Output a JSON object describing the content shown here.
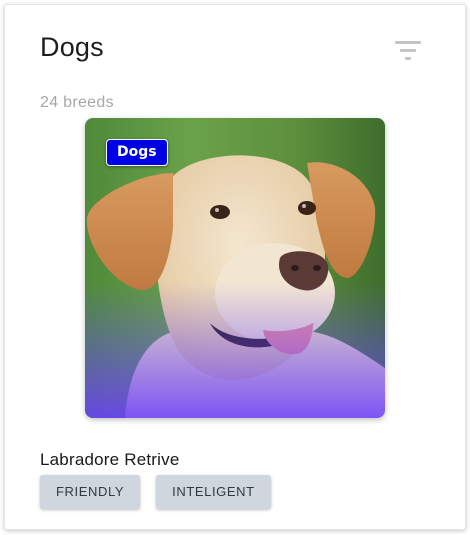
{
  "card": {
    "title": "Dogs",
    "subtitle": "24 breeds",
    "filter_icon": "filter-list-icon"
  },
  "breed": {
    "badge": "Dogs",
    "name": "Labradore Retrive",
    "image_subject": "labrador-retriever-photo",
    "tags": [
      "FRIENDLY",
      "INTELIGENT"
    ]
  },
  "colors": {
    "badge_background": "#0000e6",
    "chip_background": "#cfd6dd",
    "subtitle_text": "#a7a7a7",
    "icon_gray": "#c4c4c4"
  }
}
